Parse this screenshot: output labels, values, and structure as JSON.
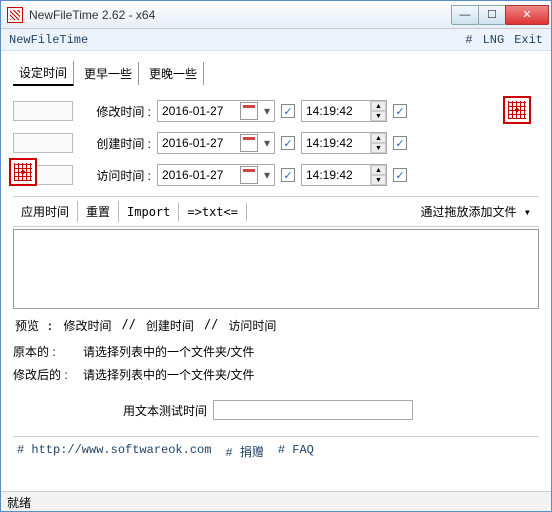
{
  "window": {
    "title": "NewFileTime 2.62 - x64"
  },
  "menubar": {
    "appname": "NewFileTime",
    "hash": "#",
    "lng": "LNG",
    "exit": "Exit"
  },
  "tabs": {
    "set": "设定时间",
    "earlier": "更早一些",
    "later": "更晚一些"
  },
  "rows": {
    "modify": {
      "label": "修改时间  :",
      "date": "2016-01-27",
      "time": "14:19:42"
    },
    "create": {
      "label": "创建时间  :",
      "date": "2016-01-27",
      "time": "14:19:42"
    },
    "access": {
      "label": "访问时间  :",
      "date": "2016-01-27",
      "time": "14:19:42"
    }
  },
  "toolbar": {
    "apply": "应用时间",
    "reset": "重置",
    "import": "Import",
    "txt": "=>txt<=",
    "dropHint": "通过拖放添加文件",
    "dd": "▾"
  },
  "preview": {
    "label": "预览 :",
    "mod": "修改时间",
    "sep": "//",
    "create": "创建时间",
    "access": "访问时间"
  },
  "compare": {
    "orig": "原本的 :",
    "after": "修改后的 :",
    "hint": "请选择列表中的一个文件夹/文件"
  },
  "test": {
    "label": "用文本测试时间",
    "value": ""
  },
  "footer": {
    "url": "# http://www.softwareok.com",
    "donate": "# 捐赠",
    "faq": "# FAQ"
  },
  "status": "就绪",
  "glyph": {
    "check": "✓",
    "up": "▲",
    "dn": "▼",
    "dd": "▾"
  }
}
